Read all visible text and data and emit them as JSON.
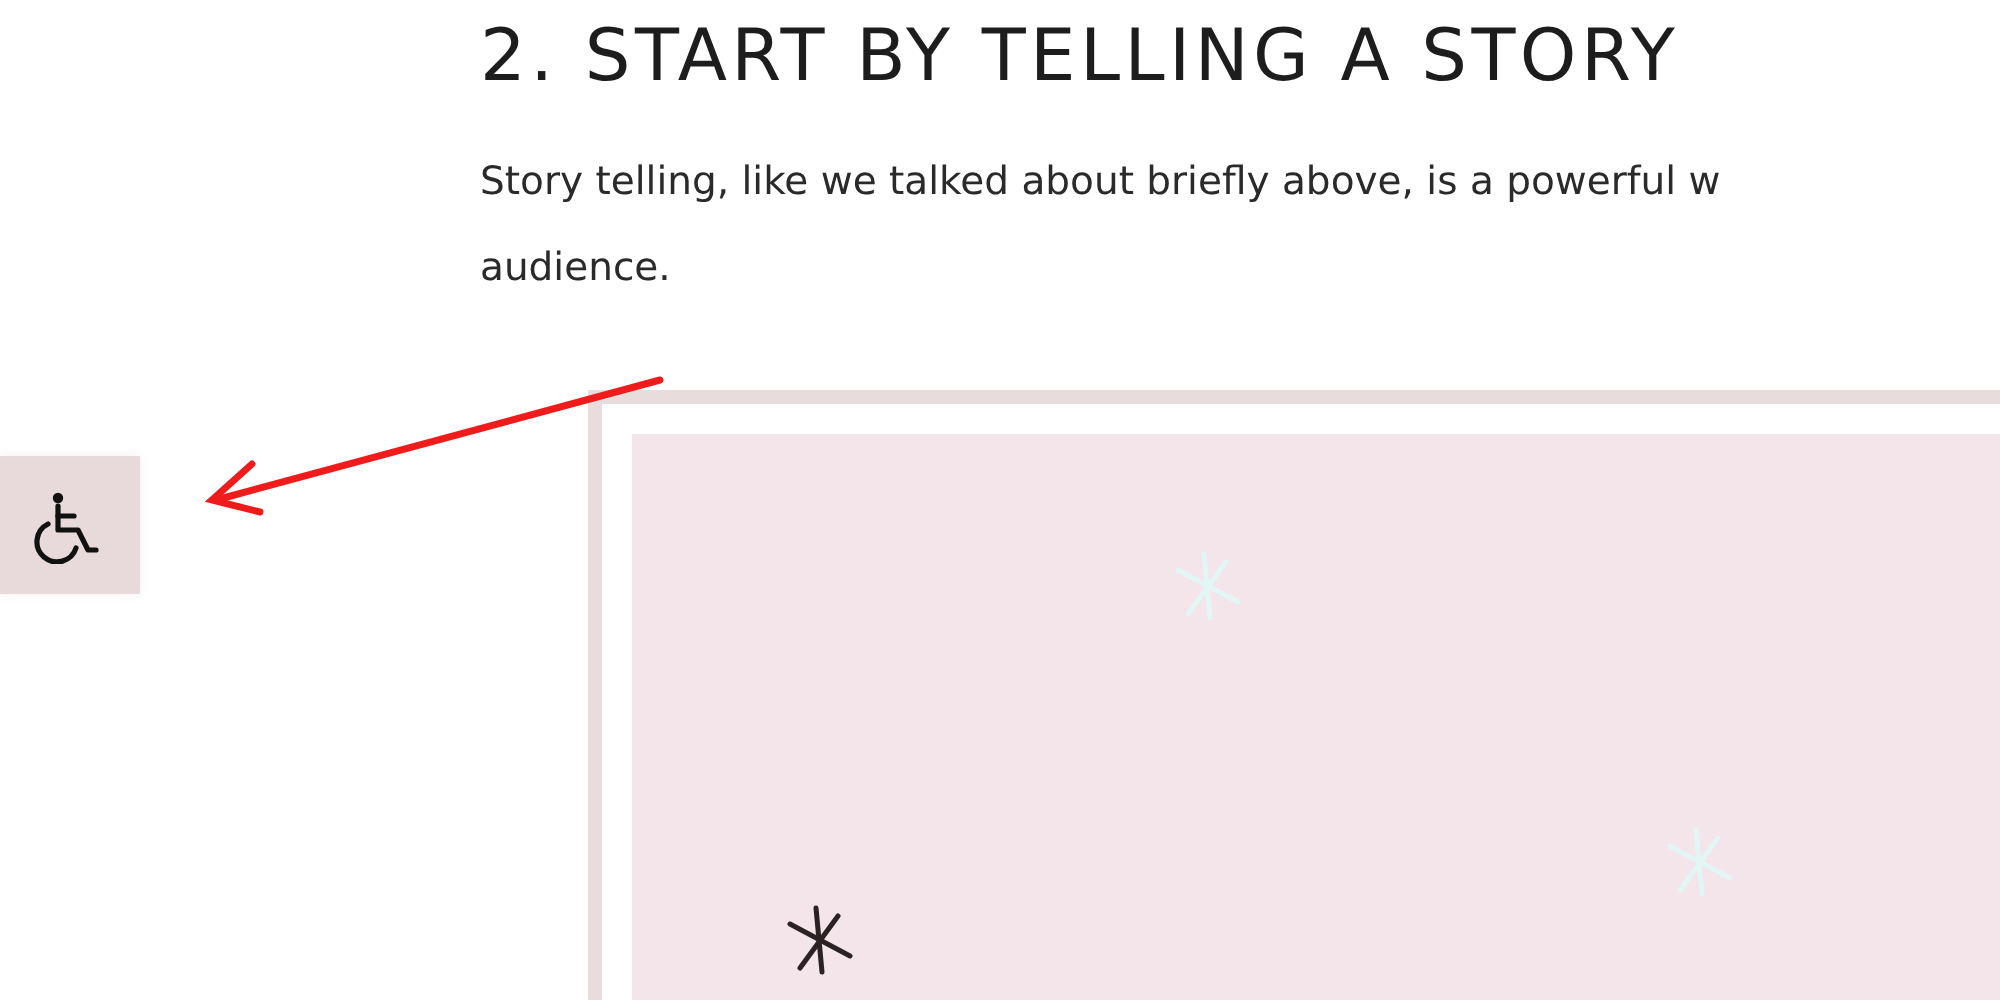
{
  "heading": "2. START BY TELLING A STORY",
  "paragraph_lines": [
    "Story telling, like we talked about briefly above, is a powerful w",
    "audience."
  ],
  "accessibility_button": {
    "kind": "wheelchair"
  }
}
